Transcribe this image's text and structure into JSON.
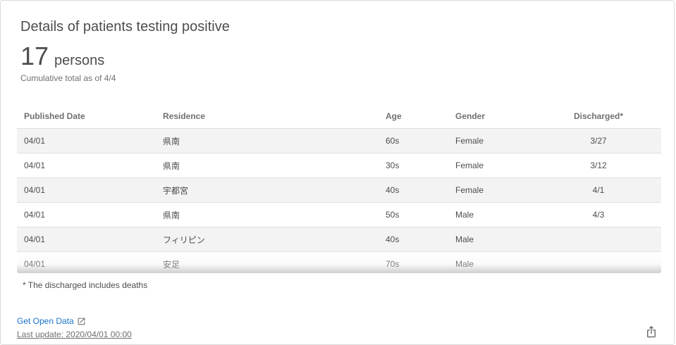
{
  "card": {
    "title": "Details of patients testing positive",
    "total_value": "17",
    "total_unit": "persons",
    "total_note": "Cumulative total as of 4/4"
  },
  "table": {
    "headers": [
      "Published Date",
      "Residence",
      "Age",
      "Gender",
      "Discharged*"
    ],
    "rows": [
      [
        "04/01",
        "県南",
        "60s",
        "Female",
        "3/27"
      ],
      [
        "04/01",
        "県南",
        "30s",
        "Female",
        "3/12"
      ],
      [
        "04/01",
        "宇都宮",
        "40s",
        "Female",
        "4/1"
      ],
      [
        "04/01",
        "県南",
        "50s",
        "Male",
        "4/3"
      ],
      [
        "04/01",
        "フィリピン",
        "40s",
        "Male",
        ""
      ],
      [
        "04/01",
        "安足",
        "70s",
        "Male",
        ""
      ]
    ]
  },
  "footnote": "* The discharged includes deaths",
  "footer": {
    "open_data_label": "Get Open Data",
    "last_update": "Last update: 2020/04/01 00:00"
  },
  "icons": {
    "open_data": "external-link-icon",
    "share": "share-icon"
  },
  "colors": {
    "link": "#1a73c9",
    "row_stripe": "#f3f3f3",
    "text": "#4d4d4d"
  }
}
